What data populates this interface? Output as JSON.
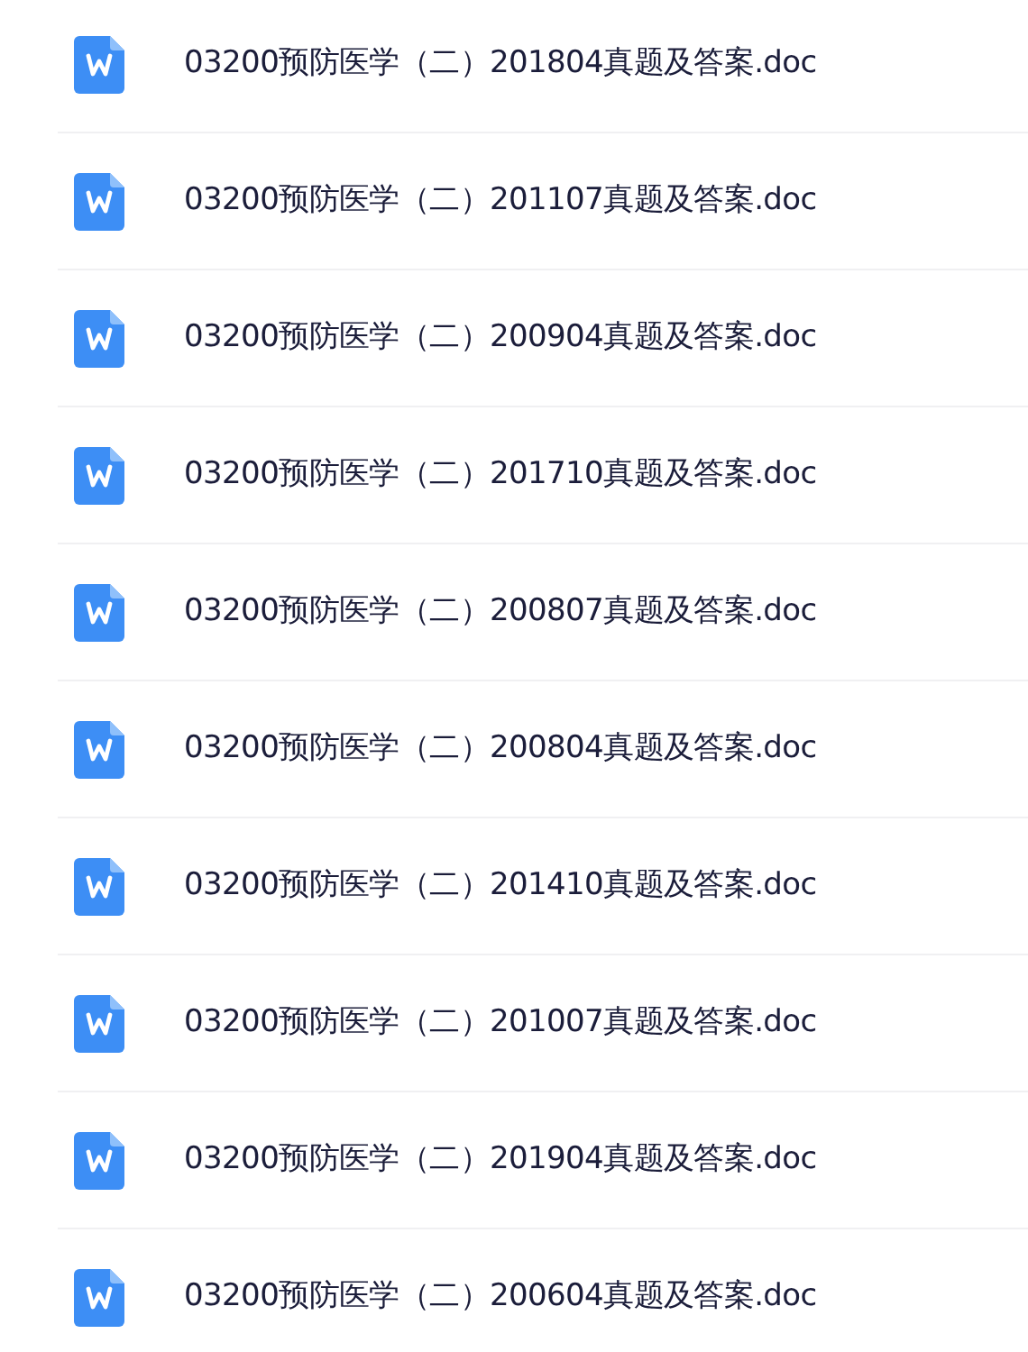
{
  "files": [
    {
      "name": "03200预防医学（二）201804真题及答案.doc"
    },
    {
      "name": "03200预防医学（二）201107真题及答案.doc"
    },
    {
      "name": "03200预防医学（二）200904真题及答案.doc"
    },
    {
      "name": "03200预防医学（二）201710真题及答案.doc"
    },
    {
      "name": "03200预防医学（二）200807真题及答案.doc"
    },
    {
      "name": "03200预防医学（二）200804真题及答案.doc"
    },
    {
      "name": "03200预防医学（二）201410真题及答案.doc"
    },
    {
      "name": "03200预防医学（二）201007真题及答案.doc"
    },
    {
      "name": "03200预防医学（二）201904真题及答案.doc"
    },
    {
      "name": "03200预防医学（二）200604真题及答案.doc"
    }
  ]
}
